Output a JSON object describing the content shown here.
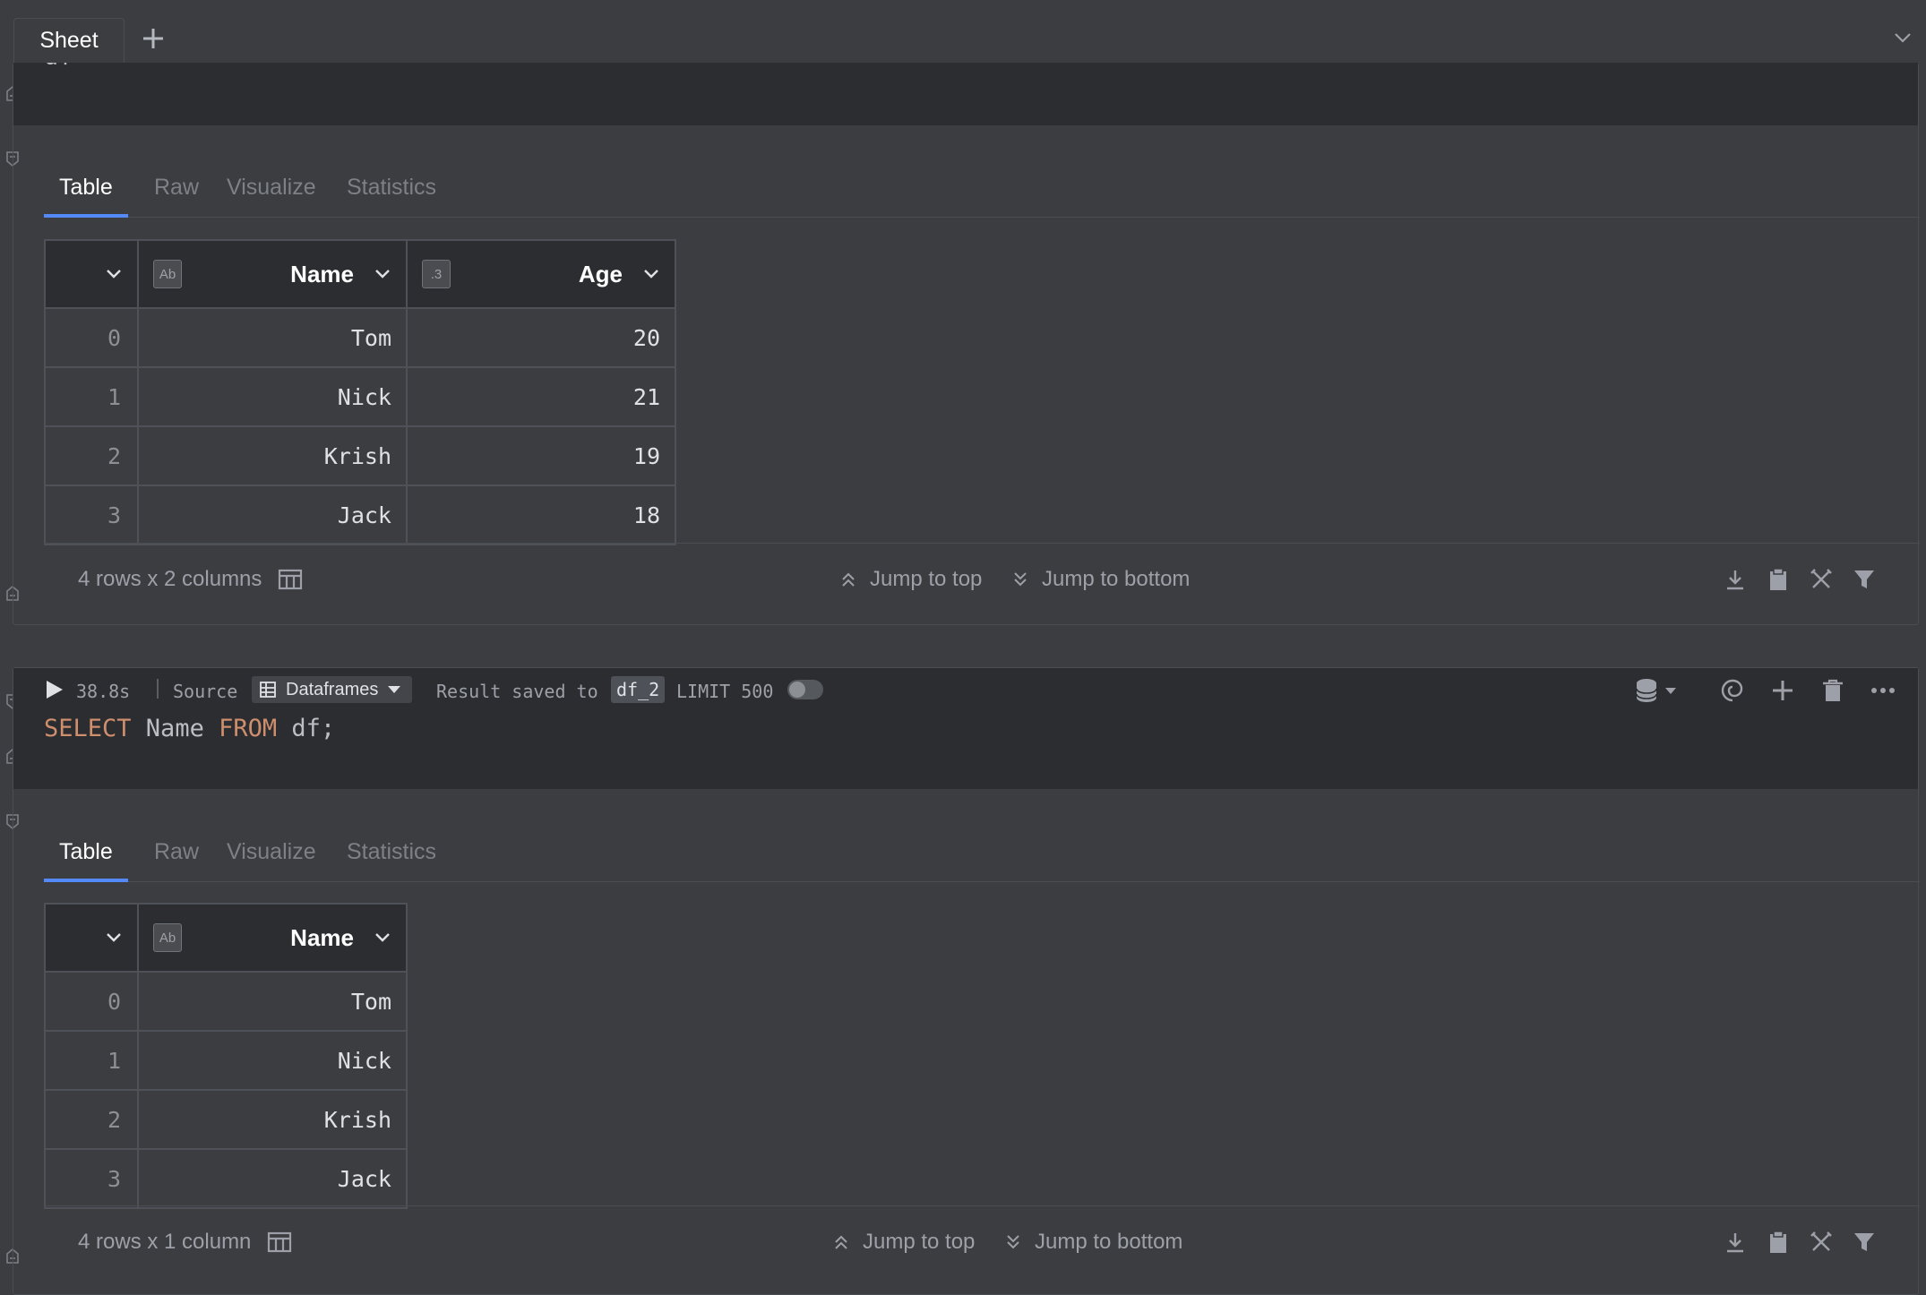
{
  "tabs": {
    "sheet_label": "Sheet"
  },
  "cell1": {
    "code_partial": "df",
    "result_tabs": [
      "Table",
      "Raw",
      "Visualize",
      "Statistics"
    ],
    "columns": [
      {
        "name": "Name",
        "type_badge": "Ab"
      },
      {
        "name": "Age",
        "type_badge": ".3"
      }
    ],
    "rows": [
      {
        "idx": "0",
        "name": "Tom",
        "age": "20"
      },
      {
        "idx": "1",
        "name": "Nick",
        "age": "21"
      },
      {
        "idx": "2",
        "name": "Krish",
        "age": "19"
      },
      {
        "idx": "3",
        "name": "Jack",
        "age": "18"
      }
    ],
    "summary": "4 rows x 2 columns",
    "jump_top": "Jump to top",
    "jump_bottom": "Jump to bottom"
  },
  "cell2": {
    "time": "38.8s",
    "source_label": "Source",
    "source_value": "Dataframes",
    "saved_label": "Result saved to",
    "saved_name": "df_2",
    "limit_label": "LIMIT 500",
    "code": {
      "kw1": "SELECT",
      "t1": " Name ",
      "kw2": "FROM",
      "t2": " df;"
    },
    "result_tabs": [
      "Table",
      "Raw",
      "Visualize",
      "Statistics"
    ],
    "columns": [
      {
        "name": "Name",
        "type_badge": "Ab"
      }
    ],
    "rows": [
      {
        "idx": "0",
        "name": "Tom"
      },
      {
        "idx": "1",
        "name": "Nick"
      },
      {
        "idx": "2",
        "name": "Krish"
      },
      {
        "idx": "3",
        "name": "Jack"
      }
    ],
    "summary": "4 rows x 1 column",
    "jump_top": "Jump to top",
    "jump_bottom": "Jump to bottom"
  },
  "colors": {
    "accent": "#548af7",
    "keyword": "#cf8e6d",
    "background": "#3b3d40",
    "editor": "#2b2d30"
  }
}
